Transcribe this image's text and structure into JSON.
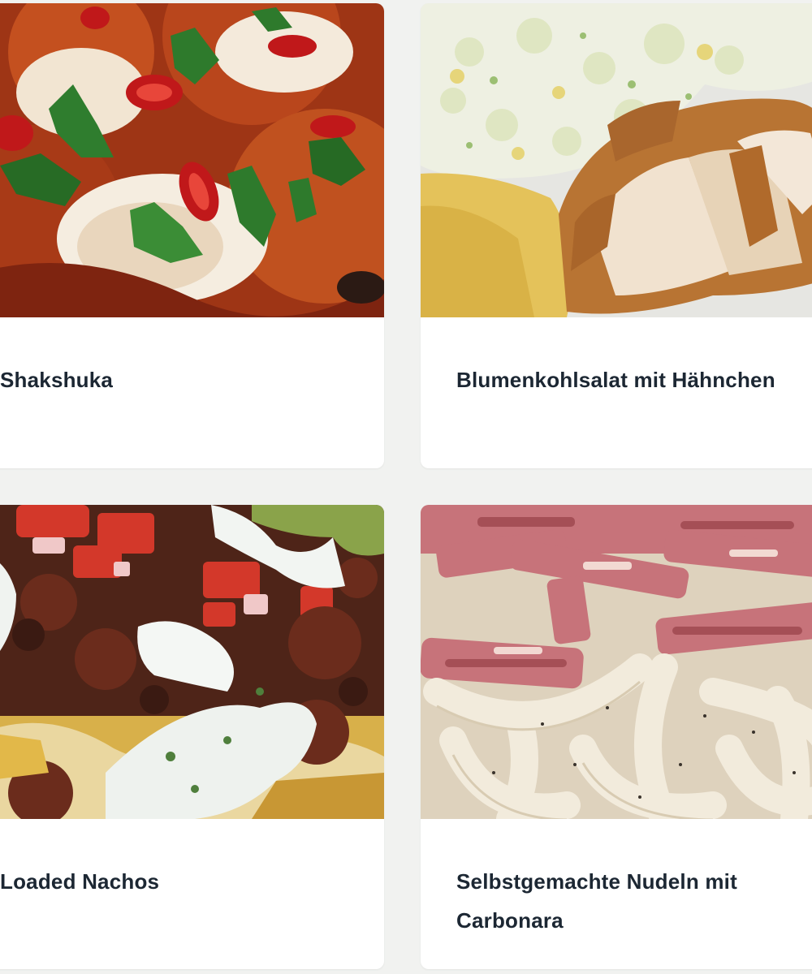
{
  "recipes": [
    {
      "title": "Shakshuka",
      "image": "shakshuka-photo",
      "colors": {
        "base": "#b8431c",
        "accent": "#d94022",
        "egg": "#f7efe2",
        "herb": "#2f7a2a"
      }
    },
    {
      "title": "Blumenkohlsalat mit Hähnchen",
      "image": "cauliflower-chicken-photo",
      "colors": {
        "base": "#e8e6dc",
        "accent": "#c98a3c",
        "sauce": "#e2c35c",
        "salad": "#e9ecd6"
      }
    },
    {
      "title": "Loaded Nachos",
      "image": "loaded-nachos-photo",
      "colors": {
        "base": "#5b2a1d",
        "accent": "#d3402b",
        "cream": "#eef2ee",
        "chip": "#e1b54b"
      }
    },
    {
      "title": "Selbstgemachte Nudeln mit Carbonara",
      "image": "carbonara-noodles-photo",
      "colors": {
        "base": "#e7dcc8",
        "accent": "#c4767a",
        "noodle": "#f1e9d8"
      }
    }
  ]
}
